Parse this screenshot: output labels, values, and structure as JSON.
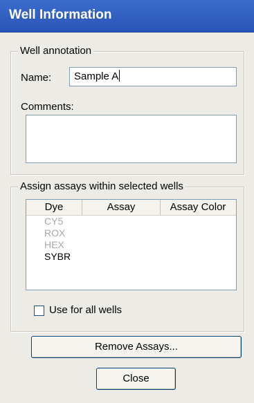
{
  "window": {
    "title": "Well Information"
  },
  "annotation": {
    "group_label": "Well annotation",
    "name_label": "Name:",
    "name_value": "Sample A",
    "comments_label": "Comments:",
    "comments_value": ""
  },
  "assays": {
    "group_label": "Assign assays within selected wells",
    "columns": [
      "Dye",
      "Assay",
      "Assay Color"
    ],
    "rows": [
      {
        "dye": "CY5",
        "assay": "",
        "color": "",
        "enabled": false
      },
      {
        "dye": "ROX",
        "assay": "",
        "color": "",
        "enabled": false
      },
      {
        "dye": "HEX",
        "assay": "",
        "color": "",
        "enabled": false
      },
      {
        "dye": "SYBR",
        "assay": "",
        "color": "",
        "enabled": true
      }
    ],
    "use_all_label": "Use for all wells",
    "use_all_checked": false
  },
  "buttons": {
    "remove_label": "Remove Assays...",
    "close_label": "Close"
  }
}
